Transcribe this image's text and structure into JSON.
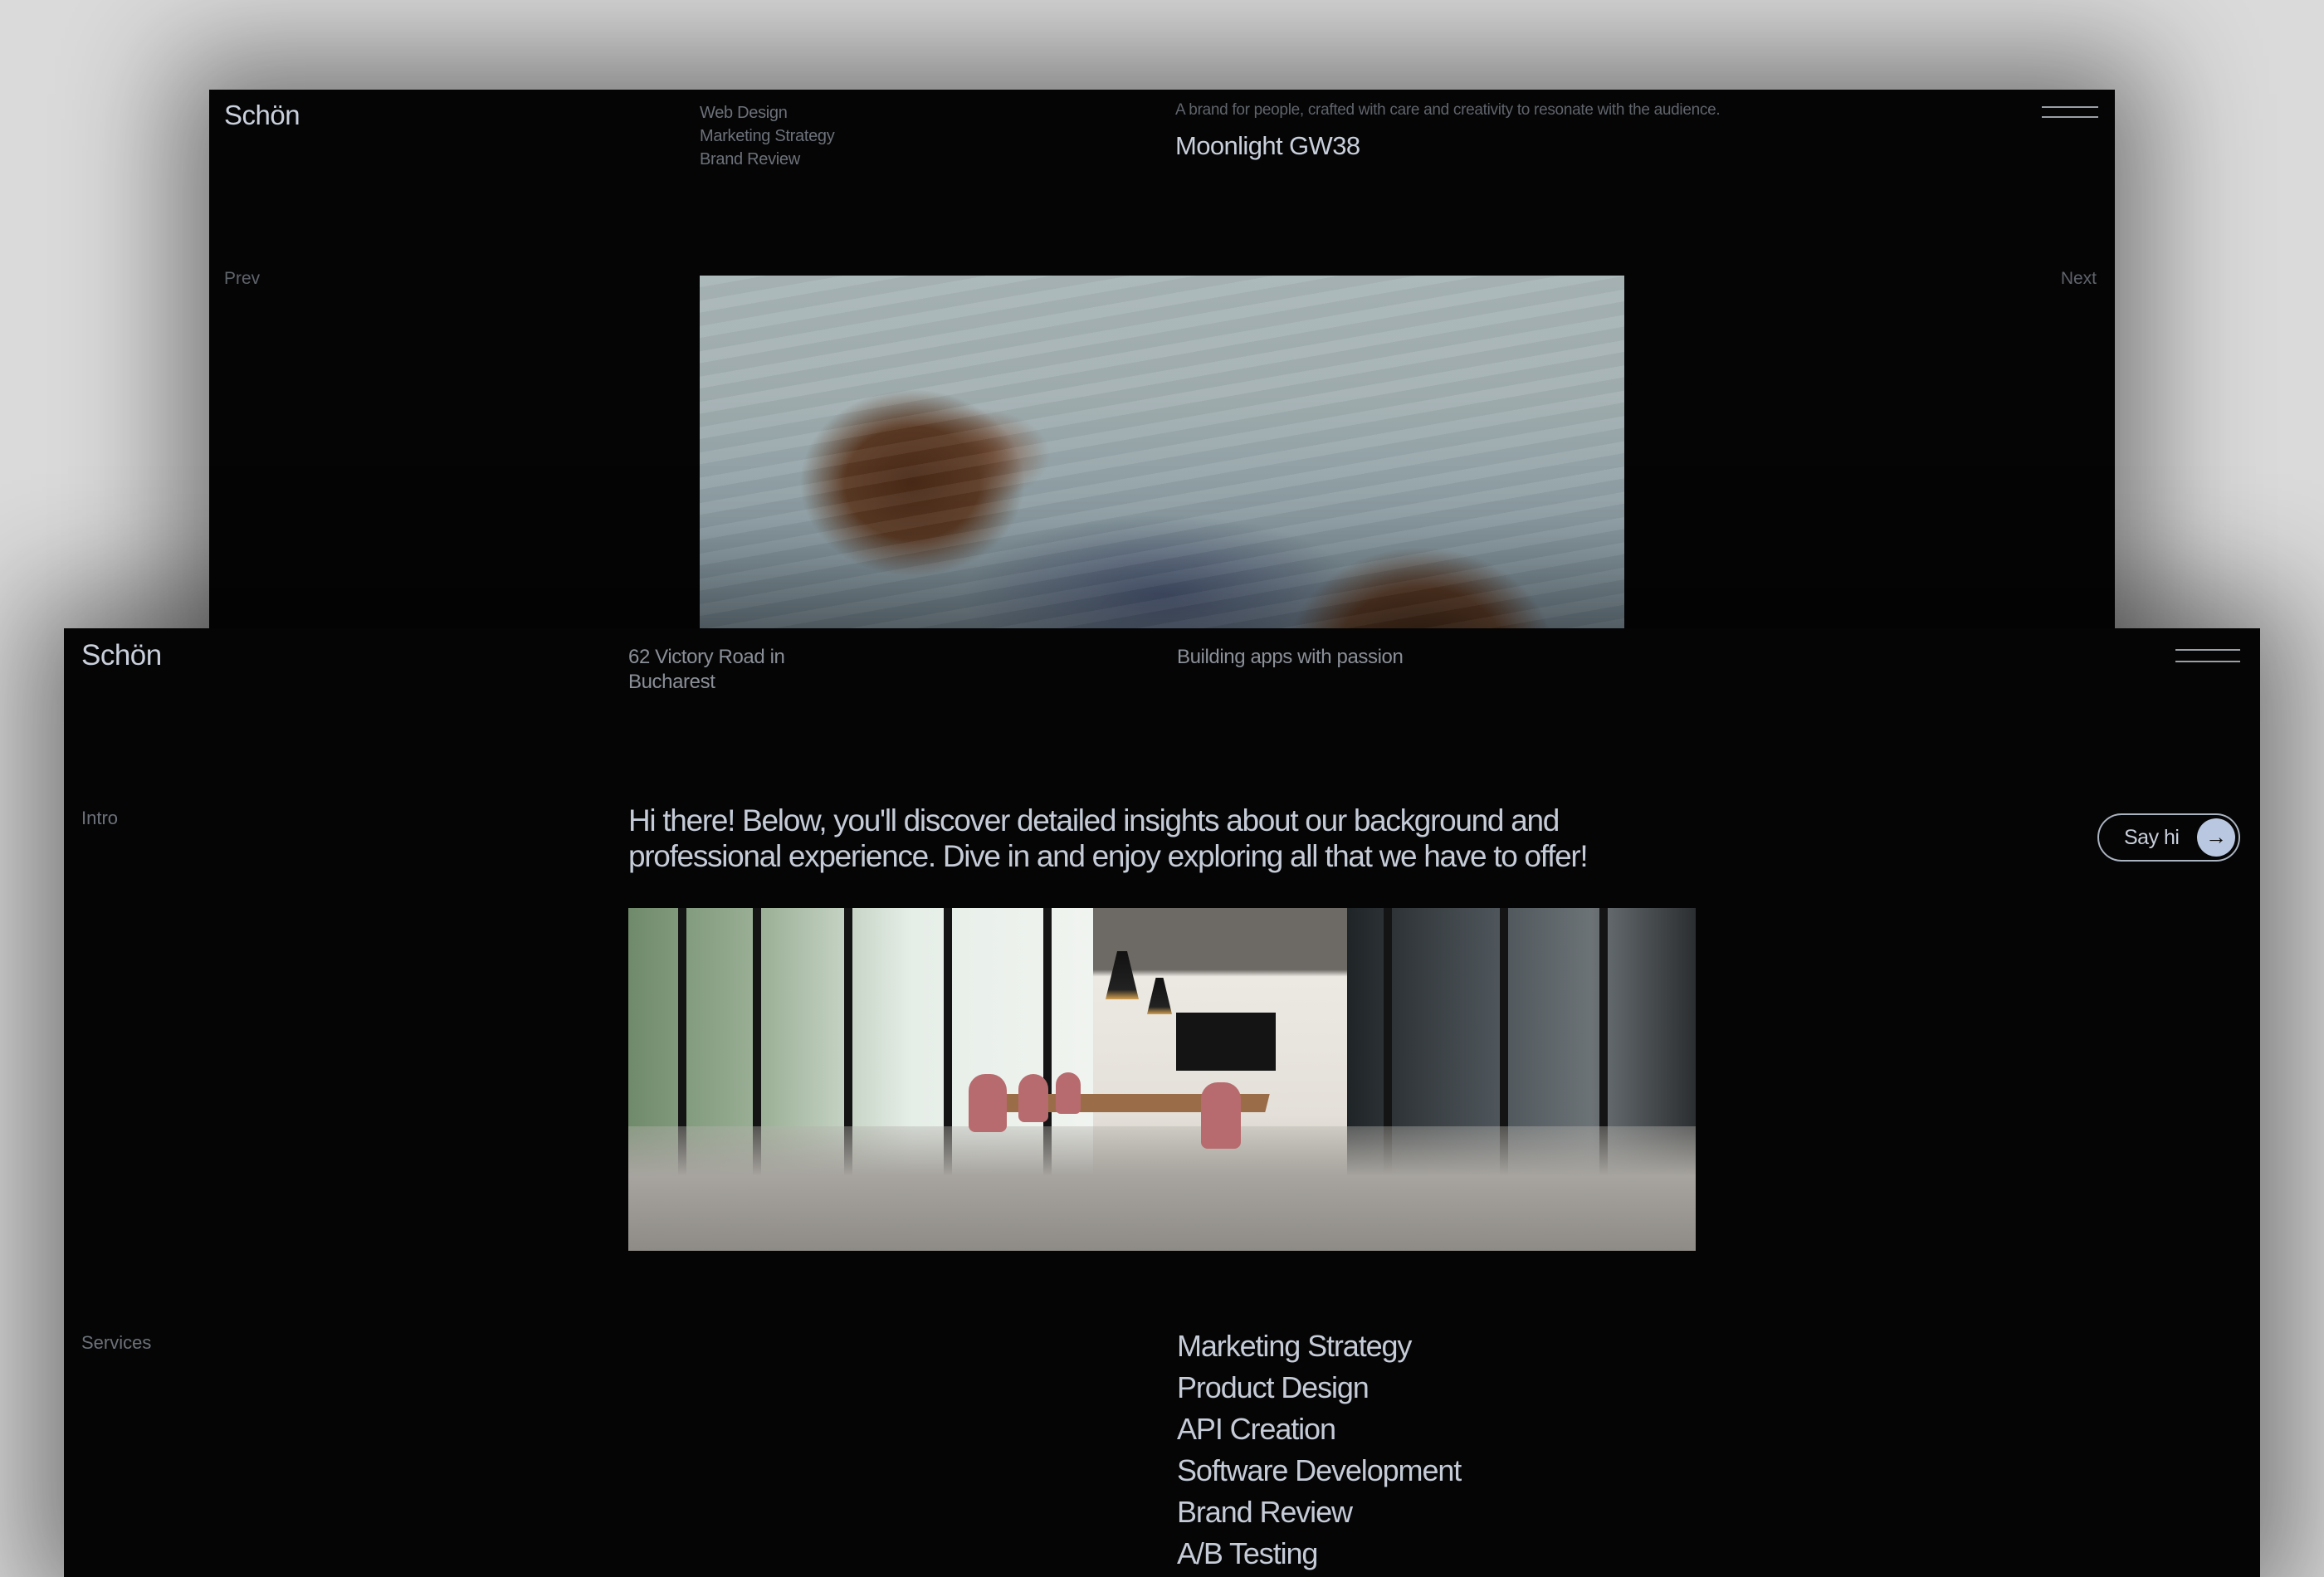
{
  "background_color": "#dadada",
  "top_window": {
    "logo": "Schön",
    "services": [
      "Web Design",
      "Marketing Strategy",
      "Brand Review"
    ],
    "tagline": "A brand for people, crafted with care and creativity to resonate with the audience.",
    "project_title": "Moonlight GW38",
    "menu_icon": "hamburger-menu-icon",
    "prev_label": "Prev",
    "next_label": "Next",
    "photo_alt": "Two people floating on their backs in calm water"
  },
  "bottom_window": {
    "logo": "Schön",
    "address_line1": "62 Victory Road in",
    "address_line2": "Bucharest",
    "tagline": "Building apps with passion",
    "menu_icon": "hamburger-menu-icon",
    "intro": {
      "label": "Intro",
      "text": "Hi there! Below, you'll discover detailed insights about our background and professional experience. Dive in and enjoy exploring all that we have to offer!"
    },
    "say_hi": {
      "label": "Say hi",
      "icon": "arrow-right-icon",
      "icon_glyph": "→",
      "accent_color": "#b9c7e0"
    },
    "photo_alt": "Modern meeting room with wooden table, pink chairs and floor-to-ceiling windows",
    "services": {
      "label": "Services",
      "items": [
        "Marketing Strategy",
        "Product Design",
        "API Creation",
        "Software Development",
        "Brand Review",
        "A/B Testing"
      ]
    }
  }
}
